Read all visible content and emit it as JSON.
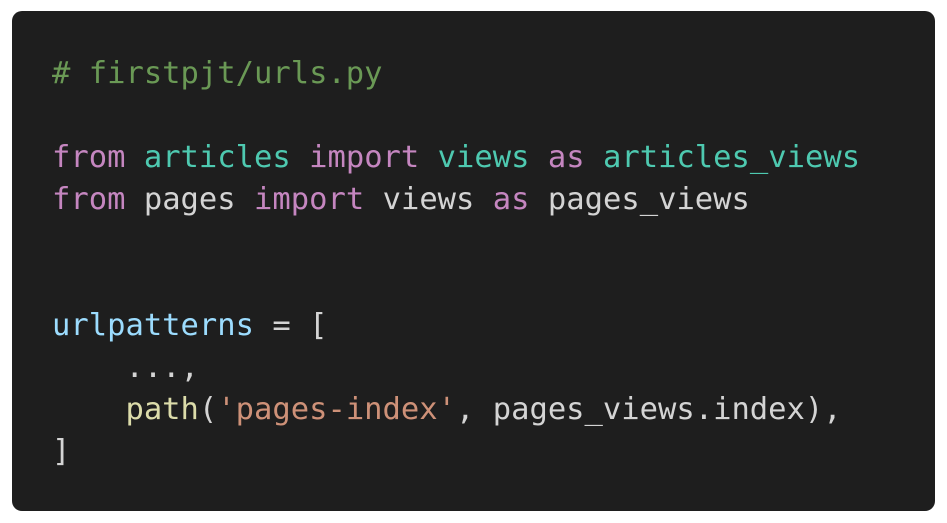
{
  "colors": {
    "background": "#1e1e1e",
    "comment": "#6a9955",
    "keyword": "#c586c0",
    "module": "#4ec9b0",
    "variable": "#9cdcfe",
    "function": "#dcdcaa",
    "string": "#ce9178",
    "plain": "#d4d4d4"
  },
  "code": {
    "line1": {
      "comment": "# firstpjt/urls.py"
    },
    "line3": {
      "kw_from": "from",
      "module": "articles",
      "kw_import": "import",
      "name": "views",
      "kw_as": "as",
      "alias": "articles_views"
    },
    "line4": {
      "kw_from": "from",
      "module": "pages",
      "kw_import": "import",
      "name": "views",
      "kw_as": "as",
      "alias": "pages_views"
    },
    "line7": {
      "var": "urlpatterns",
      "op": " = ["
    },
    "line8": {
      "text": "...,"
    },
    "line9": {
      "func": "path",
      "open": "(",
      "string": "'pages-index'",
      "rest": ", pages_views.index),"
    },
    "line10": {
      "text": "]"
    }
  }
}
